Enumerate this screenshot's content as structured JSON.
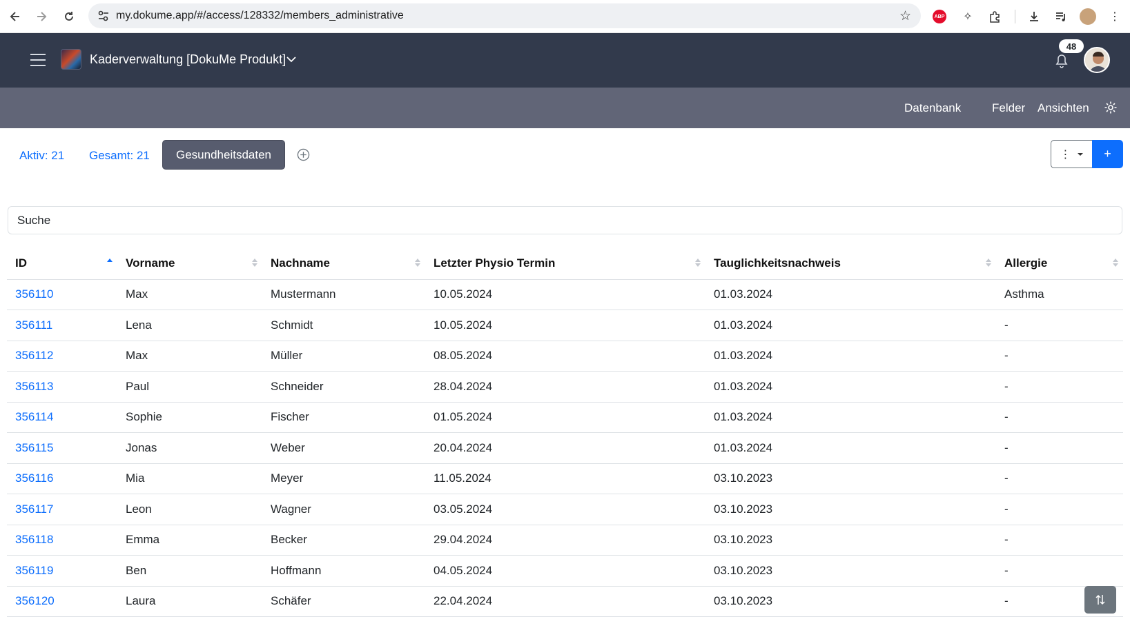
{
  "browser": {
    "url": "my.dokume.app/#/access/128332/members_administrative",
    "abp_label": "ABP"
  },
  "header": {
    "app_title": "Kaderverwaltung [DokuMe Produkt]",
    "notification_count": "48"
  },
  "subnav": {
    "items": [
      {
        "label": "Datenbank"
      },
      {
        "label": "Felder"
      },
      {
        "label": "Ansichten"
      }
    ]
  },
  "views": {
    "active_count": "Aktiv: 21",
    "total_count": "Gesamt: 21",
    "current_view": "Gesundheitsdaten",
    "more_label": "⋮",
    "add_label": "+"
  },
  "search": {
    "placeholder": "Suche"
  },
  "table": {
    "columns": [
      "ID",
      "Vorname",
      "Nachname",
      "Letzter Physio Termin",
      "Tauglichkeitsnachweis",
      "Allergie"
    ],
    "sort_column": "ID",
    "sort_direction": "ascending",
    "rows": [
      {
        "id": "356110",
        "vorname": "Max",
        "nachname": "Mustermann",
        "physio": "10.05.2024",
        "tauglichkeit": "01.03.2024",
        "allergie": "Asthma"
      },
      {
        "id": "356111",
        "vorname": "Lena",
        "nachname": "Schmidt",
        "physio": "10.05.2024",
        "tauglichkeit": "01.03.2024",
        "allergie": "-"
      },
      {
        "id": "356112",
        "vorname": "Max",
        "nachname": "Müller",
        "physio": "08.05.2024",
        "tauglichkeit": "01.03.2024",
        "allergie": "-"
      },
      {
        "id": "356113",
        "vorname": "Paul",
        "nachname": "Schneider",
        "physio": "28.04.2024",
        "tauglichkeit": "01.03.2024",
        "allergie": "-"
      },
      {
        "id": "356114",
        "vorname": "Sophie",
        "nachname": "Fischer",
        "physio": "01.05.2024",
        "tauglichkeit": "01.03.2024",
        "allergie": "-"
      },
      {
        "id": "356115",
        "vorname": "Jonas",
        "nachname": "Weber",
        "physio": "20.04.2024",
        "tauglichkeit": "01.03.2024",
        "allergie": "-"
      },
      {
        "id": "356116",
        "vorname": "Mia",
        "nachname": "Meyer",
        "physio": "11.05.2024",
        "tauglichkeit": "03.10.2023",
        "allergie": "-"
      },
      {
        "id": "356117",
        "vorname": "Leon",
        "nachname": "Wagner",
        "physio": "03.05.2024",
        "tauglichkeit": "03.10.2023",
        "allergie": "-"
      },
      {
        "id": "356118",
        "vorname": "Emma",
        "nachname": "Becker",
        "physio": "29.04.2024",
        "tauglichkeit": "03.10.2023",
        "allergie": "-"
      },
      {
        "id": "356119",
        "vorname": "Ben",
        "nachname": "Hoffmann",
        "physio": "04.05.2024",
        "tauglichkeit": "03.10.2023",
        "allergie": "-"
      },
      {
        "id": "356120",
        "vorname": "Laura",
        "nachname": "Schäfer",
        "physio": "22.04.2024",
        "tauglichkeit": "03.10.2023",
        "allergie": "-"
      }
    ]
  },
  "colors": {
    "header_bg": "#323a4c",
    "subnav_bg": "#616577",
    "link": "#0d6efd",
    "active_tab": "#575c6e"
  }
}
